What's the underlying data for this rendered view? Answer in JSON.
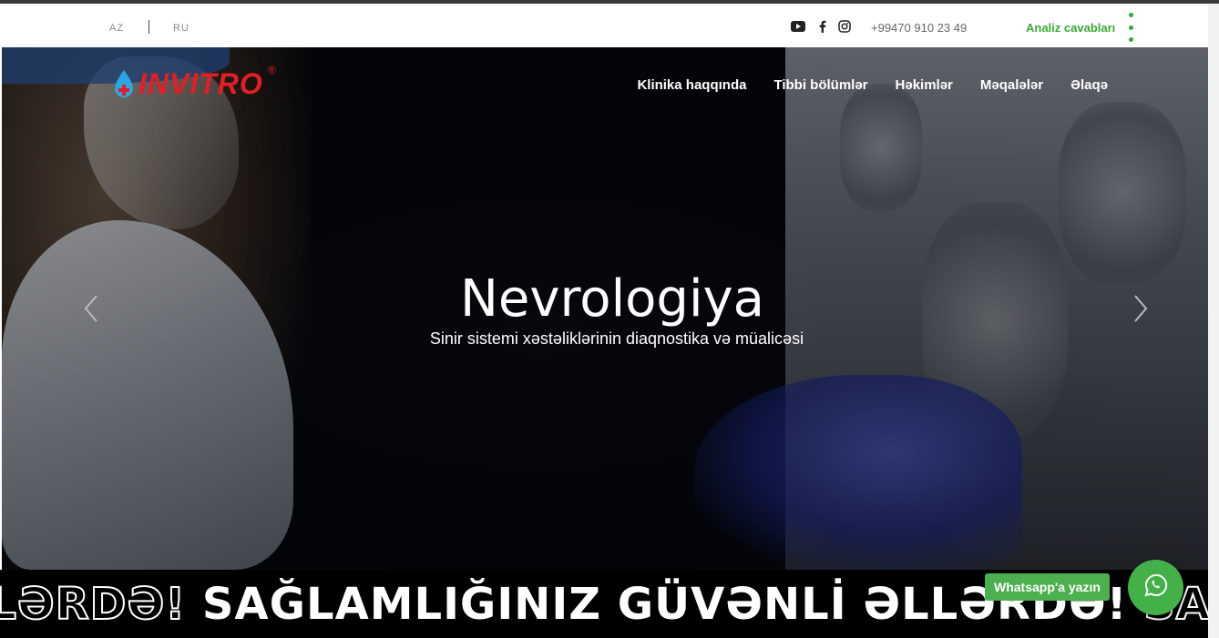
{
  "topbar": {
    "languages": [
      "AZ",
      "RU"
    ],
    "social_icons": [
      "youtube-icon",
      "facebook-icon",
      "instagram-icon"
    ],
    "phone": "+99470 910 23 49",
    "analysis_link": "Analiz cavabları"
  },
  "logo": {
    "text": "INVITRO",
    "mark": "®"
  },
  "nav": {
    "items": [
      "Klinika haqqında",
      "Tibbi bölümlər",
      "Həkimlər",
      "Məqalələr",
      "Əlaqə"
    ]
  },
  "hero": {
    "title": "Nevrologiya",
    "subtitle": "Sinir sistemi xəstəliklərinin diaqnostika və müalicəsi"
  },
  "marquee": {
    "segment_outline_1": "ƏLLƏRDƏ!",
    "segment_solid": "SAĞLAMLIĞINIZ GÜVƏNLİ ƏLLƏRDƏ!",
    "segment_outline_2": "SAĞLAML"
  },
  "whatsapp": {
    "label": "Whatsapp'a yazın"
  },
  "colors": {
    "accent_green": "#3aa935",
    "brand_red": "#e31e24",
    "whatsapp_green": "#43b048"
  }
}
